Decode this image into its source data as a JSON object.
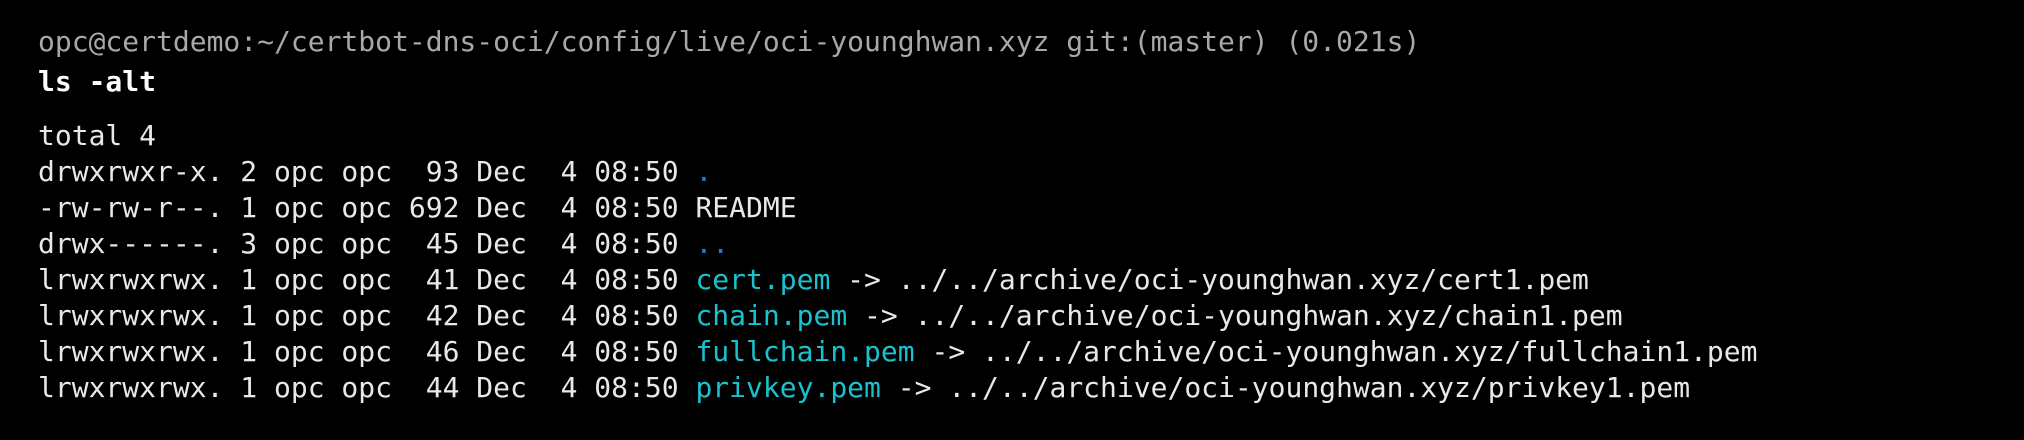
{
  "terminal": {
    "prompt": "opc@certdemo:~/certbot-dns-oci/config/live/oci-younghwan.xyz git:(master) (0.021s)",
    "command": "ls -alt",
    "total": "total 4",
    "entries": [
      {
        "prefix": "drwxrwxr-x. 2 opc opc  93 Dec  4 08:50 ",
        "name": ".",
        "type": "dir",
        "target": ""
      },
      {
        "prefix": "-rw-rw-r--. 1 opc opc 692 Dec  4 08:50 ",
        "name": "README",
        "type": "file",
        "target": ""
      },
      {
        "prefix": "drwx------. 3 opc opc  45 Dec  4 08:50 ",
        "name": "..",
        "type": "dir",
        "target": ""
      },
      {
        "prefix": "lrwxrwxrwx. 1 opc opc  41 Dec  4 08:50 ",
        "name": "cert.pem",
        "type": "link",
        "target": " -> ../../archive/oci-younghwan.xyz/cert1.pem"
      },
      {
        "prefix": "lrwxrwxrwx. 1 opc opc  42 Dec  4 08:50 ",
        "name": "chain.pem",
        "type": "link",
        "target": " -> ../../archive/oci-younghwan.xyz/chain1.pem"
      },
      {
        "prefix": "lrwxrwxrwx. 1 opc opc  46 Dec  4 08:50 ",
        "name": "fullchain.pem",
        "type": "link",
        "target": " -> ../../archive/oci-younghwan.xyz/fullchain1.pem"
      },
      {
        "prefix": "lrwxrwxrwx. 1 opc opc  44 Dec  4 08:50 ",
        "name": "privkey.pem",
        "type": "link",
        "target": " -> ../../archive/oci-younghwan.xyz/privkey1.pem"
      }
    ]
  },
  "colors": {
    "background": "#000000",
    "prompt": "#a8a8a8",
    "directory": "#2f6fd8",
    "symlink": "#19c2cf",
    "text": "#e8e8e8"
  }
}
